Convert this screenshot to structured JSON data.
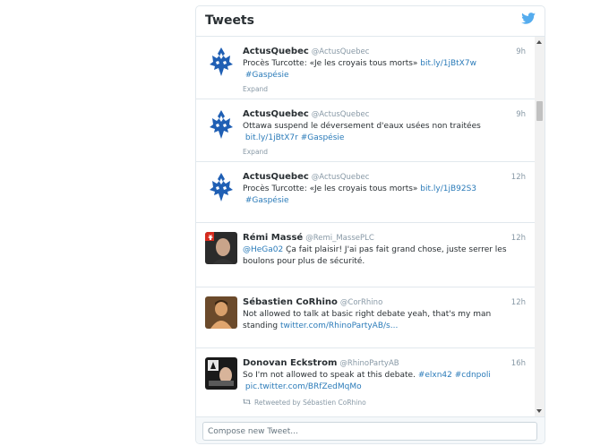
{
  "header": {
    "title": "Tweets"
  },
  "tweets": [
    {
      "name": "ActusQuebec",
      "handle": "@ActusQuebec",
      "time": "9h",
      "text": "Procès Turcotte: «Je les croyais tous morts» ",
      "link1": "bit.ly/1jBtX7w",
      "link2": "#Gaspésie",
      "expand": "Expand"
    },
    {
      "name": "ActusQuebec",
      "handle": "@ActusQuebec",
      "time": "9h",
      "text": "Ottawa suspend le déversement d'eaux usées non traitées ",
      "link1": "bit.ly/1jBtX7r",
      "link2": "#Gaspésie",
      "expand": "Expand"
    },
    {
      "name": "ActusQuebec",
      "handle": "@ActusQuebec",
      "time": "12h",
      "text": "Procès Turcotte: «Je les croyais tous morts» ",
      "link1": "bit.ly/1jB92S3",
      "link2": "#Gaspésie"
    },
    {
      "name": "Rémi Massé",
      "handle": "@Remi_MassePLC",
      "time": "12h",
      "mention": "@HeGa02",
      "text": " Ça fait plaisir! J'ai pas fait grand chose, juste serrer les boulons pour plus de sécurité."
    },
    {
      "name": "Sébastien CoRhino",
      "handle": "@CorRhino",
      "time": "12h",
      "text": "Not allowed to talk at basic right debate yeah, that's my man standing  ",
      "link1": "twitter.com/RhinoPartyAB/s..."
    },
    {
      "name": "Donovan Eckstrom",
      "handle": "@RhinoPartyAB",
      "time": "16h",
      "text": "So I'm not allowed to speak at this debate. ",
      "link1": "#elxn42",
      "link2": "#cdnpoli",
      "link3": "pic.twitter.com/BRfZedMqMo",
      "retweeted": "Retweeted by Sébastien CoRhino"
    }
  ],
  "compose": {
    "placeholder": "Compose new Tweet..."
  },
  "colors": {
    "link": "#2b7bb9",
    "bird": "#55acee",
    "quebec_blue": "#1f5fb4"
  },
  "icons": [
    "twitter-bird-icon",
    "retweet-icon",
    "scroll-up-icon",
    "scroll-down-icon"
  ]
}
